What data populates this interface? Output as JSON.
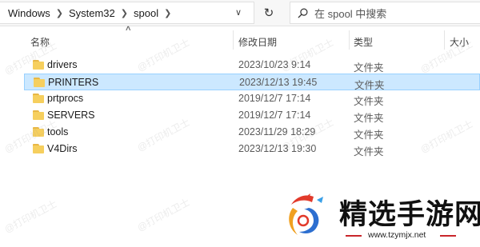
{
  "address_bar": {
    "breadcrumbs": [
      "Windows",
      "System32",
      "spool"
    ]
  },
  "search": {
    "placeholder": "在 spool 中搜索"
  },
  "columns": {
    "name": "名称",
    "date": "修改日期",
    "type": "类型",
    "size": "大小"
  },
  "files": [
    {
      "name": "drivers",
      "date": "2023/10/23 9:14",
      "type": "文件夹",
      "selected": false
    },
    {
      "name": "PRINTERS",
      "date": "2023/12/13 19:45",
      "type": "文件夹",
      "selected": true
    },
    {
      "name": "prtprocs",
      "date": "2019/12/7 17:14",
      "type": "文件夹",
      "selected": false
    },
    {
      "name": "SERVERS",
      "date": "2019/12/7 17:14",
      "type": "文件夹",
      "selected": false
    },
    {
      "name": "tools",
      "date": "2023/11/29 18:29",
      "type": "文件夹",
      "selected": false
    },
    {
      "name": "V4Dirs",
      "date": "2023/12/13 19:30",
      "type": "文件夹",
      "selected": false
    }
  ],
  "watermark": "@打印机卫士",
  "brand": {
    "title": "精选手游网",
    "url": "www.tzymjx.net"
  },
  "colors": {
    "selection": "#cce8ff",
    "folder": "#f6cf5e",
    "brand_red": "#c9262b"
  }
}
